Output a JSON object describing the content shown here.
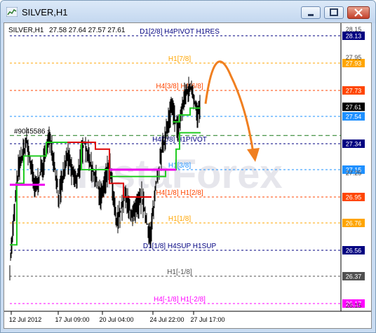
{
  "window": {
    "title": "SILVER,H1",
    "icons": [
      "chart-window-icon",
      "minimize-icon",
      "maximize-icon",
      "close-icon"
    ]
  },
  "chart_header": {
    "symbol": "SILVER,H1",
    "ohlc": "27.58 27.64 27.57 27.61",
    "order_label": "#9045586 s"
  },
  "watermark": "InstaForex",
  "levels": [
    {
      "price": "28.13",
      "label": "D1[2/8] H4PIVOT H1RES",
      "color": "#000080",
      "box": "#000080"
    },
    {
      "price": "27.93",
      "label": "H1[7/8]",
      "color": "#ffa500",
      "box": "#ffa500"
    },
    {
      "price": "27.73",
      "label": "H4[3/8] H1[6/8]",
      "color": "#ff4500",
      "box": "#ff4500"
    },
    {
      "price": "27.61",
      "label": "",
      "color": "",
      "box": "#000000"
    },
    {
      "price": "27.54",
      "label": "",
      "color": "#1e90ff",
      "box": "#1e90ff"
    },
    {
      "price": "27.34",
      "label": "H4[2/8] H1PIVOT",
      "color": "#000080",
      "box": "#000080"
    },
    {
      "price": "27.15",
      "label": "H1[3/8]",
      "color": "#1e90ff",
      "box": "#1e90ff"
    },
    {
      "price": "26.95",
      "label": "H4[1/8] H1[2/8]",
      "color": "#ff4500",
      "box": "#ff4500"
    },
    {
      "price": "26.76",
      "label": "H1[1/8]",
      "color": "#ffa500",
      "box": "#ffa500"
    },
    {
      "price": "26.56",
      "label": "D1[1/8] H4SUP H1SUP",
      "color": "#000080",
      "box": "#000080"
    },
    {
      "price": "26.37",
      "label": "H1[-1/8]",
      "color": "#505050",
      "box": "#505050"
    },
    {
      "price": "26.17",
      "label": "H4[-1/8] H1[-2/8]",
      "color": "#ff00ff",
      "box": "#ff00ff"
    }
  ],
  "partial_price_labels": [
    "28.15",
    "27.95",
    "27.25",
    "26.15"
  ],
  "x_labels": [
    "12 Jul 2012",
    "17 Jul 09:00",
    "20 Jul 04:00",
    "24 Jul 22:00",
    "27 Jul 17:00"
  ],
  "colors": {
    "price_line": "#000000",
    "green_line": "#22cc22",
    "red_line": "#dd0000",
    "magenta_line": "#ee00ee",
    "forecast_arrow": "#f07f20"
  }
}
